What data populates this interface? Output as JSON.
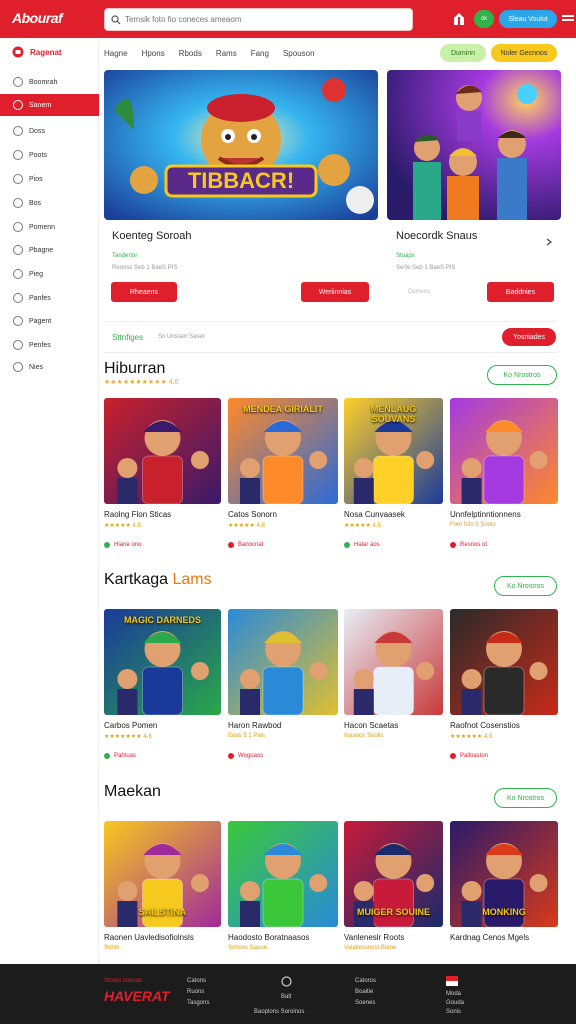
{
  "header": {
    "logo": "Abouraf",
    "search_placeholder": "Temsik foto fio coneces ameaom",
    "green_label": "ok",
    "blue_label": "Sleau Voulot"
  },
  "sidebar": {
    "heading": "Ragenat",
    "items": [
      {
        "label": "Boomrah",
        "active": false
      },
      {
        "label": "Sanem",
        "active": true
      },
      {
        "label": "Doss",
        "active": false
      },
      {
        "label": "Poots",
        "active": false
      },
      {
        "label": "Pios",
        "active": false
      },
      {
        "label": "Bos",
        "active": false
      },
      {
        "label": "Pomenn",
        "active": false
      },
      {
        "label": "Pbagne",
        "active": false
      },
      {
        "label": "Pieg",
        "active": false
      },
      {
        "label": "Panfes",
        "active": false
      },
      {
        "label": "Pagent",
        "active": false
      },
      {
        "label": "Penfes",
        "active": false
      },
      {
        "label": "Nies",
        "active": false
      }
    ]
  },
  "nav": {
    "links": [
      "Hagne",
      "Hpons",
      "Rbods",
      "Rams",
      "Fang",
      "Spouson"
    ],
    "pill_green": "Duminn",
    "pill_yellow": "Noler Gecnnos"
  },
  "hero": [
    {
      "banner_text": "TIBBACR!",
      "title": "Koenteg Soroah",
      "sub": "Tandertor",
      "meta": "Reonss Seb 1 BaeS PIS",
      "button": "Rheaens",
      "button2": "Weriinnias"
    },
    {
      "title": "Noecordk Snaus",
      "sub": "Stuaps",
      "meta": "Serfe Seb 1 BaeS PIS",
      "ghost": "Comens",
      "button": "Baddnies"
    }
  ],
  "promo": {
    "text": "Sttnfiges",
    "sub": "Sn Unssen Saser",
    "button": "Yosniades"
  },
  "sections": [
    {
      "title": "Hiburran",
      "title_accent": "",
      "rating": "★★★★★★★★★★ 4.6",
      "button": "Ko Nrostros",
      "cards": [
        {
          "banner": "",
          "title": "Raolng Flon Sticas",
          "rating": "★★★★★ 4.8",
          "tag": "Hiane ono"
        },
        {
          "banner": "MENDEA GIRIALIT",
          "title": "Catos Sonorn",
          "rating": "★★★★★ 4.8",
          "tag": "Banocnat"
        },
        {
          "banner": "MENLAUG SOUVANS",
          "title": "Nosa Cunvaasek",
          "rating": "★★★★★ 4.5",
          "tag": "Halar aos"
        },
        {
          "banner": "",
          "title": "Unnfelptinntionnens",
          "rating": "Fonr fsfo 5 Soolo",
          "tag": "Resnos ot"
        }
      ]
    },
    {
      "title": "Kartkaga",
      "title_accent": "Lams",
      "rating": "",
      "button": "Ko Nrostros",
      "cards": [
        {
          "banner": "MAGIC DARNEDS",
          "title": "Carbos Pomen",
          "rating": "★★★★★★★ 4.6",
          "tag": "Pahtuas"
        },
        {
          "banner": "",
          "title": "Haron Rawbod",
          "rating": "Eoas 5 1 Pais",
          "tag": "Wogoaos"
        },
        {
          "banner": "",
          "title": "Hacon Scaetas",
          "rating": "Inaanos Soolis",
          "tag": ""
        },
        {
          "banner": "",
          "title": "Raofnot Cosenstios",
          "rating": "★★★★★★ 4.9",
          "tag": "Palloaston"
        }
      ]
    },
    {
      "title": "Maekan",
      "title_accent": "",
      "rating": "",
      "button": "Ko Nrostros",
      "cards": [
        {
          "banner": "SAILSTINA",
          "title": "Raonen Uavledisofiolnsls",
          "rating": "Sohlo",
          "tag": ""
        },
        {
          "banner": "",
          "title": "Haodosto Boratnaasos",
          "rating": "Sohoss Sauoe",
          "tag": ""
        },
        {
          "banner": "MUIGER SOUINE",
          "title": "Vanleneslr Roots",
          "rating": "Vaiatiessnest Biane",
          "tag": ""
        },
        {
          "banner": "MONKING",
          "title": "Kardnag Cenos Mgels",
          "rating": "",
          "tag": ""
        }
      ]
    }
  ],
  "footer": {
    "logo": "HAVERAT",
    "brand_small": "Sloaot sonoas",
    "col1": [
      "Catons",
      "Ruons",
      "Tasgons"
    ],
    "col2_title": "Balt",
    "col2": "Baoplons Soroinos",
    "col3": [
      "Catoros",
      "Boaitie",
      "Soenes"
    ],
    "col4": [
      "Moda",
      "Gouda",
      "Sonis"
    ]
  },
  "colors": {
    "brand": "#e01f2d",
    "green": "#2fb34a",
    "blue": "#2ba6e8",
    "yellow": "#f7c81e"
  }
}
